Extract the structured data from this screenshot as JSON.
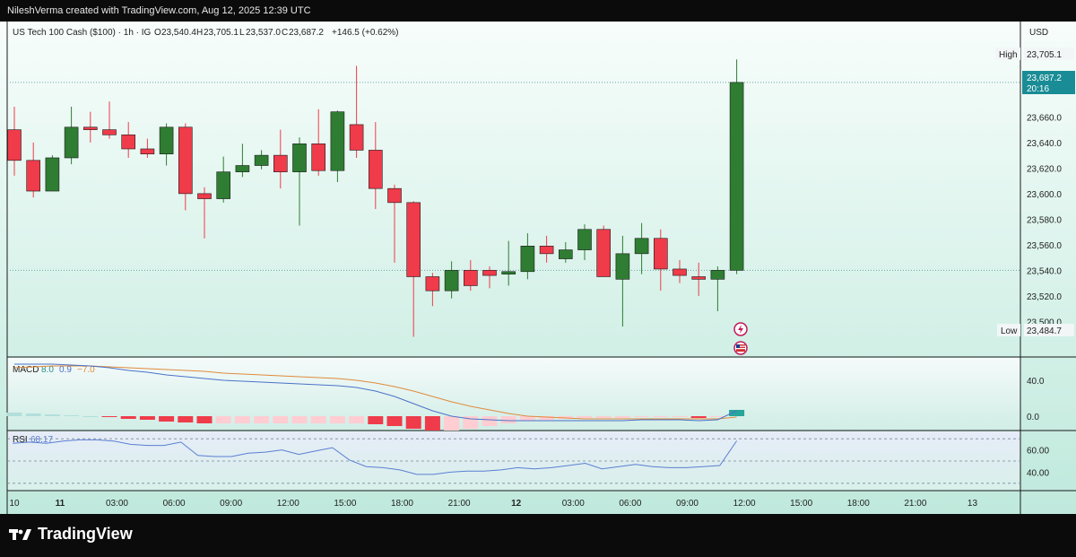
{
  "topbar": {
    "credit": "NileshVerma created with TradingView.com, Aug 12, 2025 12:39 UTC"
  },
  "header": {
    "symbol": "US Tech 100 Cash ($100) · 1h · IG",
    "o_label": "O",
    "o": "23,540.4",
    "h_label": "H",
    "h": "23,705.1",
    "l_label": "L",
    "l": "23,537.0",
    "c_label": "C",
    "c": "23,687.2",
    "change": "+146.5 (+0.62%)"
  },
  "currency": "USD",
  "price_labels": {
    "high_tag": "High",
    "high_value": "23,705.1",
    "last_value": "23,687.2",
    "last_timer": "20:16",
    "low_tag": "Low",
    "low_value": "23,484.7"
  },
  "macd_header": {
    "name": "MACD",
    "v1": "8.0",
    "v2": "0.9",
    "v3": "−7.0"
  },
  "rsi_header": {
    "name": "RSI",
    "v1": "68.17"
  },
  "brand": {
    "name": "TradingView"
  },
  "colors": {
    "up": "#2e7d32",
    "down": "#ef3b4a",
    "last": "#1a8c95",
    "macd_line": "#4a72c9",
    "signal_line": "#e08a3c",
    "rsi_line": "#5b7fd1"
  },
  "chart_data": [
    {
      "type": "candlestick",
      "title": "US Tech 100 Cash ($100) · 1h · IG",
      "ylabel": "USD",
      "ylim": [
        23475,
        23715
      ],
      "yticks": [
        23500,
        23520,
        23540,
        23560,
        23580,
        23600,
        23620,
        23640,
        23660,
        23705.1
      ],
      "ytick_labels": [
        "23,500.0",
        "23,520.0",
        "23,540.0",
        "23,560.0",
        "23,580.0",
        "23,600.0",
        "23,620.0",
        "23,640.0",
        "23,660.0"
      ],
      "xtick_labels": [
        "10",
        "11",
        "03:00",
        "06:00",
        "09:00",
        "12:00",
        "15:00",
        "18:00",
        "21:00",
        "12",
        "03:00",
        "06:00",
        "09:00",
        "12:00",
        "15:00",
        "18:00",
        "21:00",
        "13"
      ],
      "xtick_index": [
        0,
        2.4,
        5.4,
        8.4,
        11.4,
        14.4,
        17.4,
        20.4,
        23.4,
        26.4,
        29.4,
        32.4,
        35.4,
        38.4,
        41.4,
        44.4,
        47.4,
        50.4
      ],
      "candles": [
        [
          23650,
          23668,
          23614,
          23626
        ],
        [
          23626,
          23640,
          23597,
          23602
        ],
        [
          23602,
          23630,
          23602,
          23628
        ],
        [
          23628,
          23668,
          23623,
          23652
        ],
        [
          23652,
          23664,
          23640,
          23650
        ],
        [
          23650,
          23672,
          23643,
          23646
        ],
        [
          23646,
          23656,
          23628,
          23635
        ],
        [
          23635,
          23643,
          23628,
          23631
        ],
        [
          23631,
          23655,
          23622,
          23652
        ],
        [
          23652,
          23655,
          23587,
          23600
        ],
        [
          23600,
          23605,
          23565,
          23596
        ],
        [
          23596,
          23629,
          23593,
          23617
        ],
        [
          23617,
          23639,
          23613,
          23622
        ],
        [
          23622,
          23634,
          23619,
          23630
        ],
        [
          23630,
          23650,
          23604,
          23617
        ],
        [
          23617,
          23644,
          23575,
          23639
        ],
        [
          23639,
          23666,
          23614,
          23618
        ],
        [
          23618,
          23665,
          23609,
          23664
        ],
        [
          23654,
          23700,
          23628,
          23634
        ],
        [
          23634,
          23656,
          23588,
          23604
        ],
        [
          23604,
          23607,
          23546,
          23593
        ],
        [
          23593,
          23594,
          23488,
          23535
        ],
        [
          23535,
          23538,
          23512,
          23524
        ],
        [
          23524,
          23547,
          23518,
          23540
        ],
        [
          23540,
          23548,
          23524,
          23528
        ],
        [
          23540,
          23543,
          23526,
          23536
        ],
        [
          23537,
          23563,
          23528,
          23539
        ],
        [
          23539,
          23569,
          23533,
          23559
        ],
        [
          23559,
          23567,
          23546,
          23553
        ],
        [
          23549,
          23562,
          23546,
          23556
        ],
        [
          23556,
          23576,
          23548,
          23572
        ],
        [
          23572,
          23575,
          23536,
          23535
        ],
        [
          23533,
          23567,
          23496,
          23553
        ],
        [
          23553,
          23577,
          23537,
          23565
        ],
        [
          23565,
          23572,
          23524,
          23541
        ],
        [
          23541,
          23548,
          23530,
          23536
        ],
        [
          23535,
          23546,
          23520,
          23533
        ],
        [
          23533,
          23543,
          23508,
          23540
        ],
        [
          23540,
          23705,
          23537,
          23687
        ]
      ]
    },
    {
      "type": "macd",
      "title": "MACD",
      "values_shown": [
        8.0,
        0.9,
        -7.0
      ],
      "ylim": [
        -12,
        62
      ],
      "ytick_labels": [
        "40.0",
        "0.0"
      ],
      "yticks": [
        40,
        0
      ],
      "macd_line": [
        58,
        58,
        58,
        57,
        56,
        54,
        51,
        49,
        46,
        44,
        42,
        40,
        39,
        38,
        37,
        36,
        35,
        34,
        32,
        28,
        22,
        14,
        6,
        0,
        -3,
        -4,
        -5,
        -5,
        -5,
        -5,
        -5,
        -5,
        -5,
        -4,
        -4,
        -4,
        -5,
        -4,
        6
      ],
      "signal_line": [
        54,
        55,
        56,
        56,
        56,
        55,
        54,
        53,
        52,
        51,
        50,
        48,
        47,
        46,
        45,
        44,
        43,
        42,
        40,
        37,
        33,
        28,
        22,
        16,
        11,
        7,
        3,
        0,
        -1,
        -2,
        -3,
        -3,
        -3,
        -3,
        -3,
        -3,
        -3,
        -3,
        -1
      ],
      "histogram": [
        4,
        3,
        2,
        1,
        0,
        -1,
        -3,
        -4,
        -6,
        -7,
        -8,
        -8,
        -8,
        -8,
        -8,
        -8,
        -8,
        -8,
        -8,
        -9,
        -11,
        -14,
        -16,
        -16,
        -14,
        -11,
        -8,
        -5,
        -4,
        -3,
        -2,
        -2,
        -2,
        -1,
        -1,
        -1,
        -2,
        -1,
        7
      ]
    },
    {
      "type": "line",
      "title": "RSI",
      "values_shown": [
        68.17
      ],
      "ylim": [
        25,
        75
      ],
      "yticks": [
        60,
        40
      ],
      "ytick_labels": [
        "60.00",
        "40.00"
      ],
      "bands": [
        70,
        50,
        30
      ],
      "values": [
        66,
        67,
        66,
        68,
        69,
        69,
        68,
        65,
        64,
        64,
        67,
        55,
        54,
        54,
        57,
        58,
        60,
        56,
        59,
        62,
        51,
        45,
        44,
        42,
        38,
        38,
        40,
        41,
        41,
        42,
        44,
        43,
        44,
        46,
        48,
        43,
        45,
        47,
        45,
        44,
        44,
        45,
        46,
        68.17
      ]
    }
  ]
}
